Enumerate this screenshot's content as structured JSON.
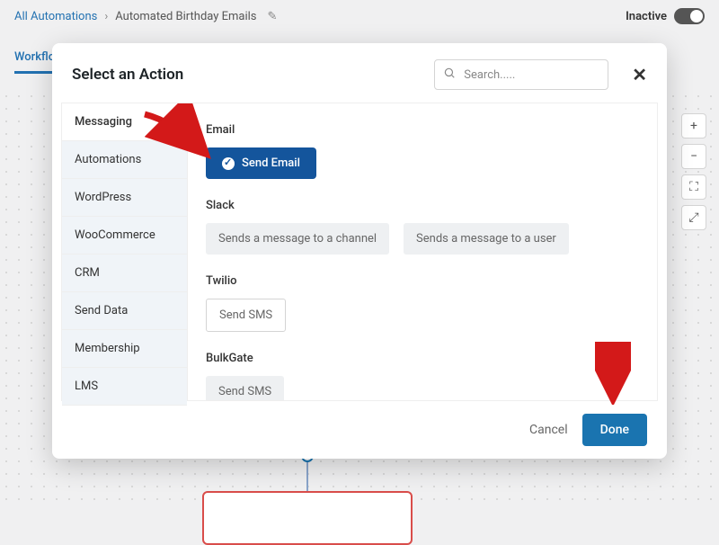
{
  "breadcrumb": {
    "root": "All Automations",
    "current": "Automated Birthday Emails"
  },
  "status": {
    "label": "Inactive"
  },
  "tabs": [
    "Workflow"
  ],
  "modal": {
    "title": "Select an Action",
    "search_placeholder": "Search.....",
    "sidebar": {
      "items": [
        "Messaging",
        "Automations",
        "WordPress",
        "WooCommerce",
        "CRM",
        "Send Data",
        "Membership",
        "LMS"
      ],
      "active": 0
    },
    "sections": [
      {
        "title": "Email",
        "actions": [
          {
            "label": "Send Email",
            "style": "primary"
          }
        ]
      },
      {
        "title": "Slack",
        "actions": [
          {
            "label": "Sends a message to a channel",
            "style": "chip"
          },
          {
            "label": "Sends a message to a user",
            "style": "chip"
          }
        ]
      },
      {
        "title": "Twilio",
        "actions": [
          {
            "label": "Send SMS",
            "style": "light"
          }
        ]
      },
      {
        "title": "BulkGate",
        "actions": [
          {
            "label": "Send SMS",
            "style": "chip"
          }
        ]
      }
    ],
    "buttons": {
      "cancel": "Cancel",
      "done": "Done"
    }
  }
}
